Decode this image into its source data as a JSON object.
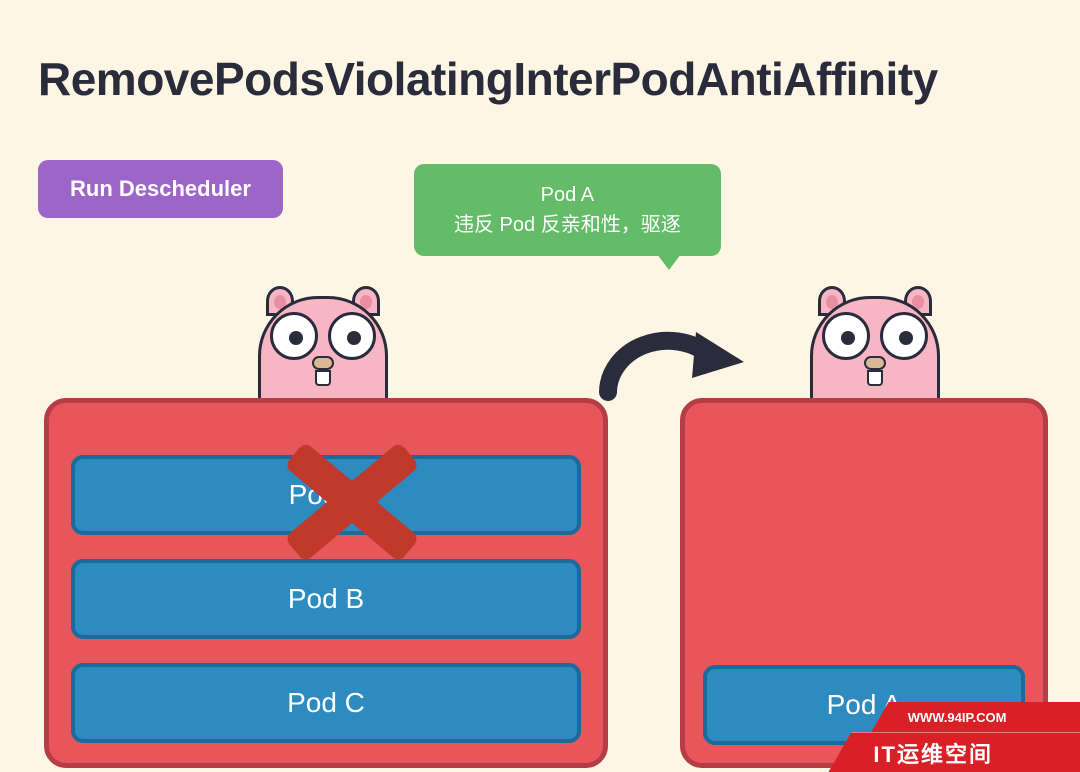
{
  "title": "RemovePodsViolatingInterPodAntiAffinity",
  "run_button": "Run Descheduler",
  "speech": {
    "line1": "Pod A",
    "line2": "违反 Pod 反亲和性，驱逐"
  },
  "node_left": {
    "pods": [
      "Pod A",
      "Pod B",
      "Pod C"
    ],
    "evicted_index": 0
  },
  "node_right": {
    "pods": [
      "Pod A"
    ]
  },
  "icons": {
    "gopher": "gopher-mascot",
    "arrow": "curved-arrow-right",
    "cross": "red-cross"
  },
  "banner": {
    "url": "WWW.94IP.COM",
    "brand": "IT运维空间"
  },
  "colors": {
    "bg": "#fdf6e5",
    "title": "#2a2c3c",
    "button": "#9d65c9",
    "speech": "#64bc69",
    "node_fill": "#e8555a",
    "node_border": "#b53d45",
    "pod_fill": "#2e8bc0",
    "pod_border": "#1a6a9a",
    "cross": "#c0392b",
    "banner": "#d92027"
  }
}
